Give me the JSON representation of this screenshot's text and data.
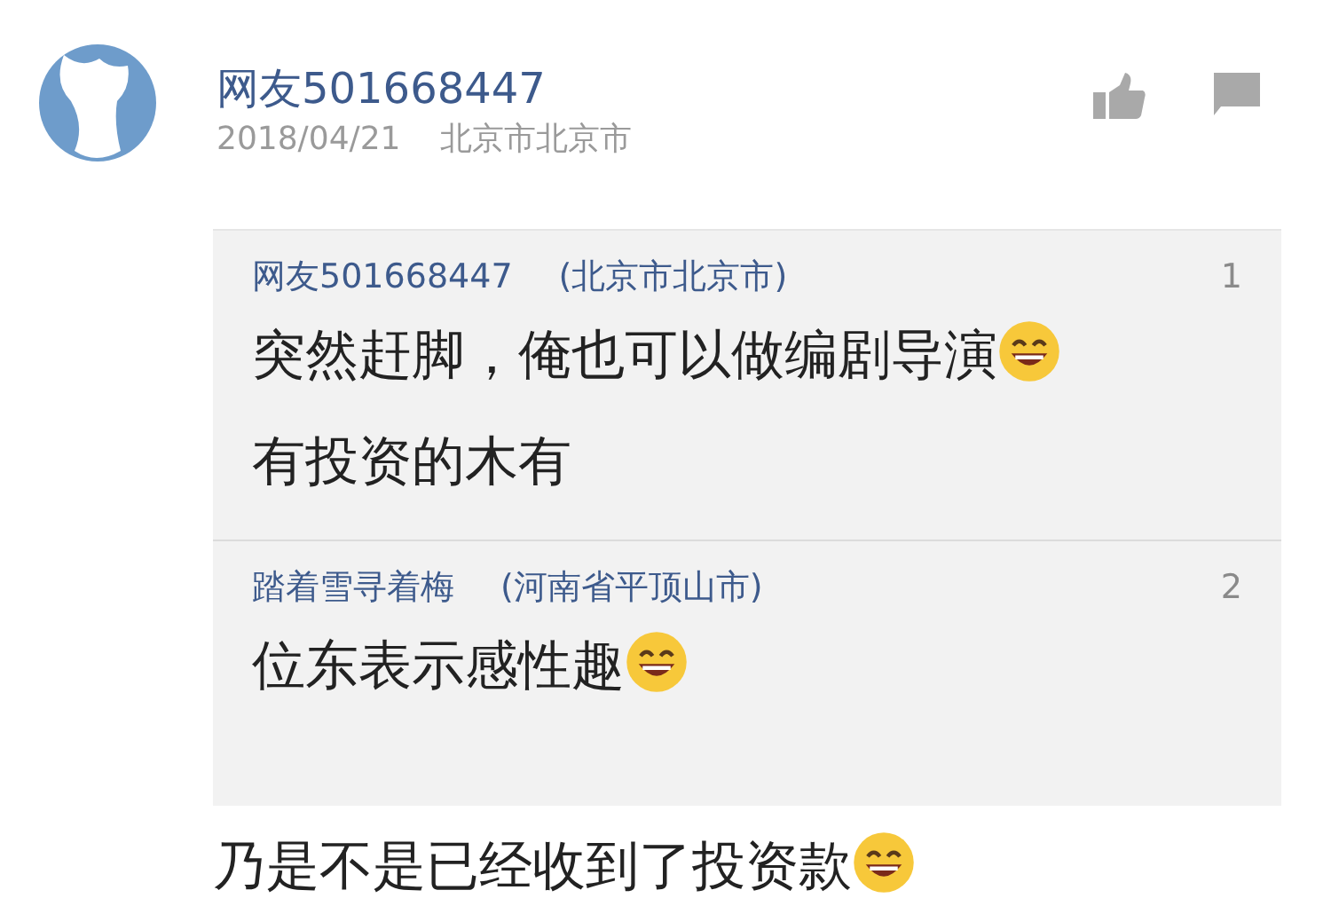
{
  "comment": {
    "user": "网友501668447",
    "date": "2018/04/21",
    "location": "北京市北京市",
    "replies": [
      {
        "user": "网友501668447",
        "location": "(北京市北京市)",
        "floor": "1",
        "lines": [
          {
            "text": "突然赶脚，俺也可以做编剧导演",
            "emoji": true
          },
          {
            "text": "有投资的木有",
            "emoji": false
          }
        ]
      },
      {
        "user": "踏着雪寻着梅",
        "location": "(河南省平顶山市)",
        "floor": "2",
        "lines": [
          {
            "text": "位东表示感性趣",
            "emoji": true
          }
        ]
      }
    ],
    "body": {
      "text": "乃是不是已经收到了投资款",
      "emoji": true
    }
  }
}
